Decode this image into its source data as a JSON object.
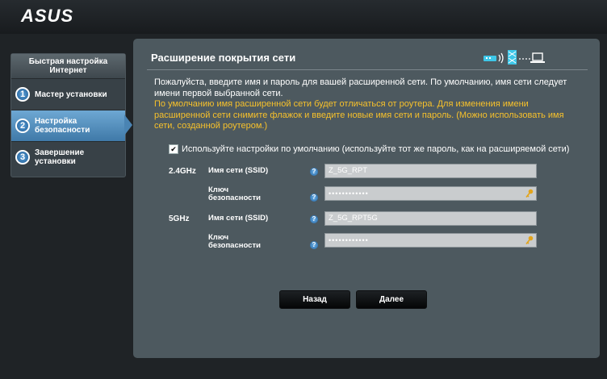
{
  "brand": "ASUS",
  "sidebar": {
    "header": "Быстрая настройка Интернет",
    "steps": [
      {
        "num": "1",
        "label": "Мастер установки"
      },
      {
        "num": "2",
        "label": "Настройка безопасности"
      },
      {
        "num": "3",
        "label": "Завершение установки"
      }
    ]
  },
  "main": {
    "title": "Расширение покрытия сети",
    "desc_white": "Пожалуйста, введите имя и пароль для вашей расширенной сети. По умолчанию, имя сети следует имени первой выбранной сети.",
    "desc_orange": "По умолчанию имя расширенной сети будет отличаться от роутера. Для изменения имени расширенной сети снимите флажок и введите новые имя сети и пароль. (Можно использовать имя сети, созданной роутером.)",
    "default_checkbox_label": "Используйте настройки по умолчанию (используйте тот же пароль, как на расширяемой сети)",
    "default_checked": true,
    "bands": [
      {
        "band": "2.4GHz",
        "ssid_label": "Имя сети (SSID)",
        "ssid_value": "Z_5G_RPT",
        "key_label_1": "Ключ",
        "key_label_2": "безопасности",
        "key_value": "••••••••••••"
      },
      {
        "band": "5GHz",
        "ssid_label": "Имя сети (SSID)",
        "ssid_value": "Z_5G_RPT5G",
        "key_label_1": "Ключ",
        "key_label_2": "безопасности",
        "key_value": "••••••••••••"
      }
    ],
    "help_glyph": "?",
    "back_button": "Назад",
    "next_button": "Далее"
  },
  "colors": {
    "accent_orange": "#f7c12b",
    "active_step": "#4a84b3",
    "panel": "#4d595f"
  }
}
